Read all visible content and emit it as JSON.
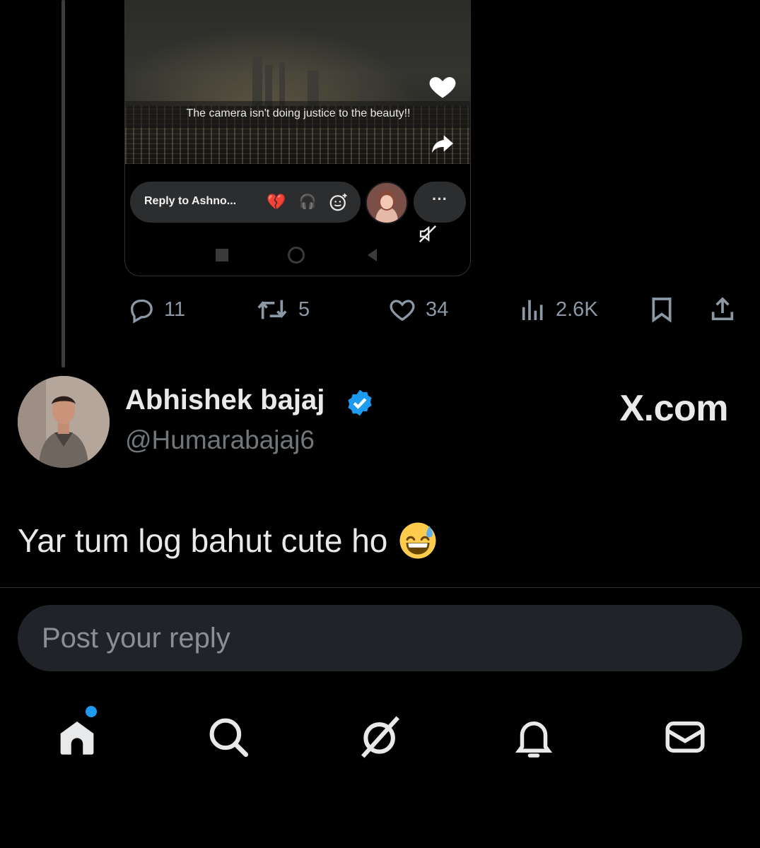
{
  "media": {
    "caption": "The camera isn't doing justice to the beauty!!",
    "reply_placeholder": "Reply to Ashno...",
    "more_label": "···",
    "reactions": [
      "💔",
      "🎧",
      "☺"
    ]
  },
  "actions": {
    "replies": "11",
    "reposts": "5",
    "likes": "34",
    "views": "2.6K"
  },
  "user": {
    "display_name": "Abhishek bajaj",
    "handle": "@Humarabajaj6",
    "verified": true
  },
  "brand": "X.com",
  "tweet": {
    "text": "Yar tum log bahut cute ho",
    "emoji": "grinning-face-with-sweat"
  },
  "reply_box": {
    "placeholder": "Post your reply"
  },
  "nav": {
    "items": [
      "home-icon",
      "search-icon",
      "grok-icon",
      "notifications-icon",
      "messages-icon"
    ],
    "home_has_badge": true
  },
  "colors": {
    "background": "#000000",
    "accent": "#1d9bf0",
    "muted_text": "#71767b"
  }
}
